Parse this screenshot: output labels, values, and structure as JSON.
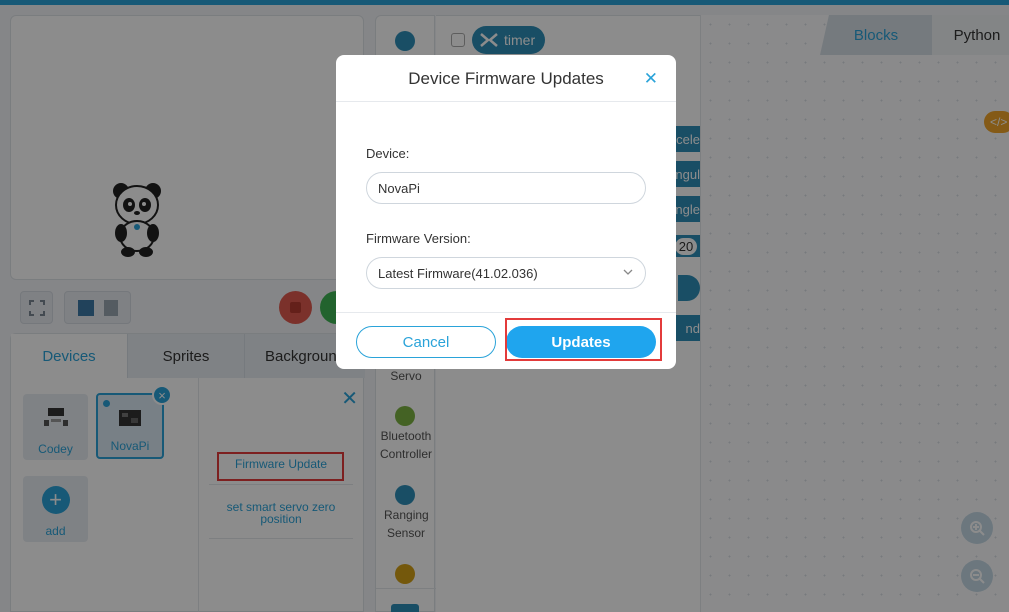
{
  "devices_panel": {
    "tabs": [
      "Devices",
      "Sprites",
      "Backgroun"
    ],
    "devices": [
      {
        "label": "Codey"
      },
      {
        "label": "NovaPi"
      }
    ],
    "add_label": "add",
    "menu": {
      "firmware_update": "Firmware Update",
      "smart_servo_zero": "set smart servo zero position"
    }
  },
  "categories": {
    "servo": "Servo",
    "bluetooth": "Bluetooth Controller",
    "ranging": "Ranging Sensor"
  },
  "palette": {
    "timer_label": "timer",
    "accel_label": "ccele",
    "angul_label": "ngul",
    "angle_label": "ngle",
    "value_20": "20",
    "and_label": "nd"
  },
  "workspace": {
    "tab_blocks": "Blocks",
    "tab_python": "Python",
    "code_badge": "</>"
  },
  "modal": {
    "title": "Device Firmware Updates",
    "device_label": "Device:",
    "device_value": "NovaPi",
    "firmware_label": "Firmware Version:",
    "firmware_value": "Latest Firmware(41.02.036)",
    "cancel_label": "Cancel",
    "update_label": "Updates"
  },
  "colors": {
    "accent": "#2aa3d9",
    "highlight": "#e33b3b",
    "update_button": "#1fa5ee"
  }
}
